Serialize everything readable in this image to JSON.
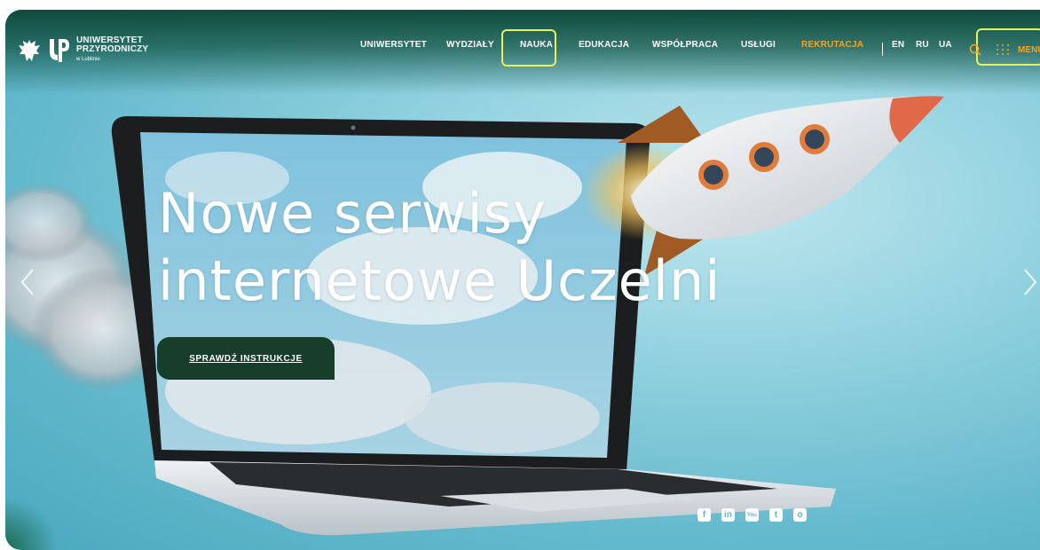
{
  "logo": {
    "line1": "UNIWERSYTET",
    "line2": "PRZYRODNICZY",
    "line3": "w Lublinie"
  },
  "nav": {
    "items": [
      {
        "label": "UNIWERSYTET"
      },
      {
        "label": "WYDZIAŁY"
      },
      {
        "label": "NAUKA"
      },
      {
        "label": "EDUKACJA"
      },
      {
        "label": "WSPÓŁPRACA"
      },
      {
        "label": "USŁUGI"
      },
      {
        "label": "REKRUTACJA"
      }
    ],
    "languages": [
      "EN",
      "RU",
      "UA"
    ],
    "menu_label": "MENU"
  },
  "hero": {
    "title_line1": "Nowe serwisy",
    "title_line2": "internetowe Uczelni",
    "cta_label": "SPRAWDŹ INSTRUKCJE"
  },
  "social": {
    "facebook": "f",
    "linkedin": "in",
    "youtube": "You",
    "twitter": "t",
    "instagram": "o"
  },
  "colors": {
    "accent_orange": "#f0a52a",
    "highlight_yellow": "#e8f35a",
    "cta_green": "#173d2b",
    "header_green": "#0f4a3c"
  },
  "icons": {
    "search": "search-icon",
    "menu": "grid-dots-icon",
    "prev": "chevron-left-icon",
    "next": "chevron-right-icon"
  }
}
